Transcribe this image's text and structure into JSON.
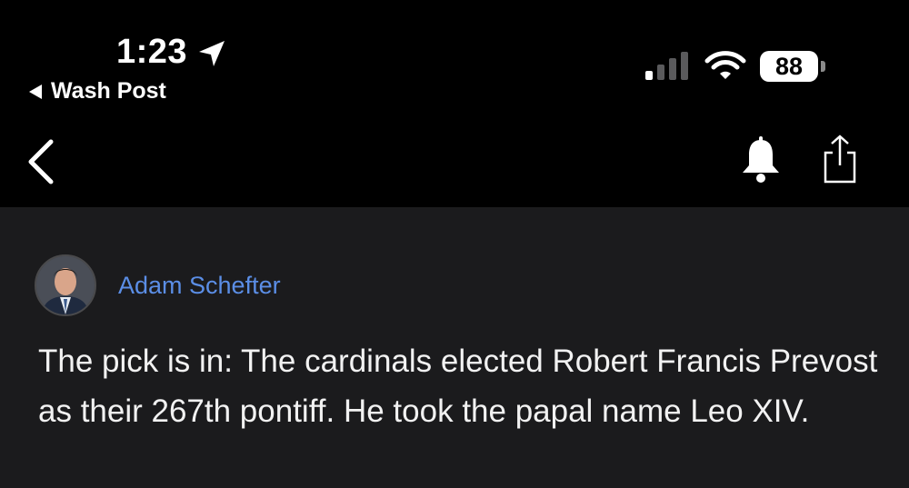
{
  "status_bar": {
    "time": "1:23",
    "back_app_label": "Wash Post",
    "battery_level": "88",
    "signal_bars_active": 1,
    "signal_bars_total": 4
  },
  "nav": {
    "icons": [
      "chevron-left-icon",
      "bell-icon",
      "share-icon"
    ]
  },
  "post": {
    "author": "Adam Schefter",
    "text": "The pick is in: The cardinals elected Robert Francis Prevost as their 267th pontiff. He took the papal name Leo XIV."
  },
  "colors": {
    "background": "#1b1b1d",
    "bar_background": "#000000",
    "author_link": "#5b8ee6",
    "text": "#f2f2f2"
  }
}
